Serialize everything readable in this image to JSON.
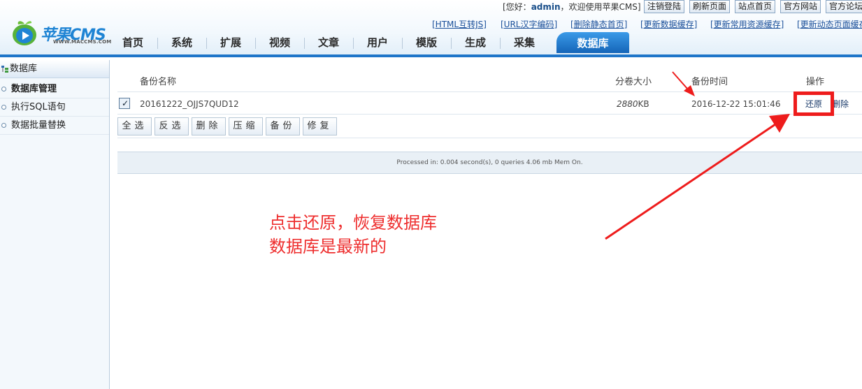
{
  "brand": {
    "logo_text": "苹果CMS",
    "logo_url": "WWW.MACCMS.COM"
  },
  "topbar": {
    "welcome_prefix": "[您好：",
    "username": "admin",
    "welcome_suffix": "，欢迎使用苹果CMS]",
    "buttons": [
      "注销登陆",
      "刷新页面",
      "站点首页",
      "官方网站",
      "官方论坛"
    ]
  },
  "quick_links": [
    "[HTML互转JS]",
    "[URL汉字编码]",
    "[删除静态首页]",
    "[更新数据缓存]",
    "[更新常用资源缓存]",
    "[更新动态页面缓存"
  ],
  "nav": {
    "items": [
      "首页",
      "系统",
      "扩展",
      "视频",
      "文章",
      "用户",
      "模版",
      "生成",
      "采集"
    ],
    "active": "数据库"
  },
  "sidebar": {
    "title": "数据库",
    "items": [
      {
        "label": "数据库管理",
        "active": true
      },
      {
        "label": "执行SQL语句",
        "active": false
      },
      {
        "label": "数据批量替换",
        "active": false
      }
    ]
  },
  "table": {
    "headers": {
      "name": "备份名称",
      "size": "分卷大小",
      "time": "备份时间",
      "ops": "操作"
    },
    "rows": [
      {
        "checked": true,
        "name": "20161222_OJJS7QUD12",
        "size_value": "2880",
        "size_unit": "KB",
        "time": "2016-12-22 15:01:46",
        "restore": "还原",
        "delete": "删除"
      }
    ]
  },
  "actions": [
    "全选",
    "反选",
    "删除",
    "压缩",
    "备份",
    "修复"
  ],
  "footer": "Processed in: 0.004 second(s), 0 queries 4.06 mb Mem On.",
  "annotation": {
    "line1": "点击还原，恢复数据库",
    "line2": "数据库是最新的"
  },
  "colors": {
    "accent": "#1e75c9",
    "annotation": "#ee2e2e"
  }
}
